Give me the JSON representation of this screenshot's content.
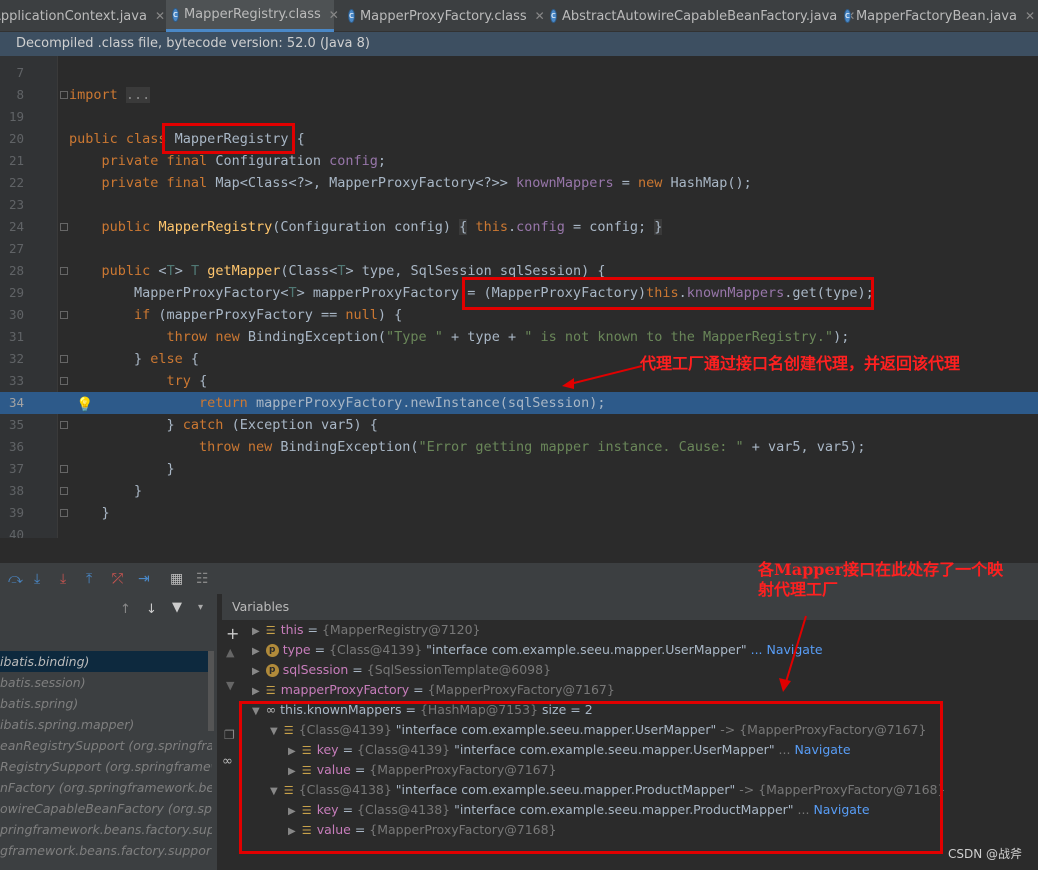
{
  "tabs": [
    {
      "label": "ApplicationContext.java",
      "active": false
    },
    {
      "label": "MapperRegistry.class",
      "active": true
    },
    {
      "label": "MapperProxyFactory.class",
      "active": false
    },
    {
      "label": "AbstractAutowireCapableBeanFactory.java",
      "active": false
    },
    {
      "label": "MapperFactoryBean.java",
      "active": false
    }
  ],
  "banner": "Decompiled .class file, bytecode version: 52.0 (Java 8)",
  "code_lines": [
    {
      "num": "7"
    },
    {
      "num": "8"
    },
    {
      "num": "19"
    },
    {
      "num": "20"
    },
    {
      "num": "21"
    },
    {
      "num": "22"
    },
    {
      "num": "23"
    },
    {
      "num": "24"
    },
    {
      "num": "27"
    },
    {
      "num": "28"
    },
    {
      "num": "29"
    },
    {
      "num": "30"
    },
    {
      "num": "31"
    },
    {
      "num": "32"
    },
    {
      "num": "33"
    },
    {
      "num": "34"
    },
    {
      "num": "35"
    },
    {
      "num": "36"
    },
    {
      "num": "37"
    },
    {
      "num": "38"
    },
    {
      "num": "39"
    },
    {
      "num": "40"
    }
  ],
  "annotations": {
    "proxy_note": "代理工厂通过接口名创建代理，并返回该代理",
    "map_note": "各Mapper接口在此处存了一个映射代理工厂"
  },
  "frames": [
    "ibatis.binding)",
    "batis.session)",
    "batis.spring)",
    "ibatis.spring.mapper)",
    "eanRegistrySupport (org.springframew",
    "RegistrySupport (org.springframewor",
    "nFactory (org.springframework.beans",
    "owireCapableBeanFactory (org.spring",
    "pringframework.beans.factory.support",
    "gframework.beans.factory.support)"
  ],
  "variables_title": "Variables",
  "variables": {
    "this": {
      "name": "this",
      "value": "{MapperRegistry@7120}"
    },
    "type": {
      "name": "type",
      "value": "{Class@4139}",
      "str": "\"interface com.example.seeu.mapper.UserMapper\"",
      "nav": "... Navigate"
    },
    "sqlSession": {
      "name": "sqlSession",
      "value": "{SqlSessionTemplate@6098}"
    },
    "mapperProxyFactory": {
      "name": "mapperProxyFactory",
      "value": "{MapperProxyFactory@7167}"
    },
    "knownMappers": {
      "name": "this.knownMappers",
      "value": "{HashMap@7153}",
      "size": "size = 2"
    },
    "entry1": {
      "key": "{Class@4139}",
      "str": "\"interface com.example.seeu.mapper.UserMapper\"",
      "arrow": "->",
      "val": "{MapperProxyFactory@7167}"
    },
    "entry1_key": {
      "name": "key",
      "value": "{Class@4139}",
      "str": "\"interface com.example.seeu.mapper.UserMapper\"",
      "nav": "Navigate"
    },
    "entry1_value": {
      "name": "value",
      "value": "{MapperProxyFactory@7167}"
    },
    "entry2": {
      "key": "{Class@4138}",
      "str": "\"interface com.example.seeu.mapper.ProductMapper\"",
      "arrow": "->",
      "val": "{MapperProxyFactory@7168}"
    },
    "entry2_key": {
      "name": "key",
      "value": "{Class@4138}",
      "str": "\"interface com.example.seeu.mapper.ProductMapper\"",
      "nav": "Navigate"
    },
    "entry2_value": {
      "name": "value",
      "value": "{MapperProxyFactory@7168}"
    }
  },
  "watermark": "CSDN @战斧",
  "colors": {
    "annotation": "#e10000",
    "highlight_line": "#2d5a8a",
    "navigate": "#589df6"
  }
}
